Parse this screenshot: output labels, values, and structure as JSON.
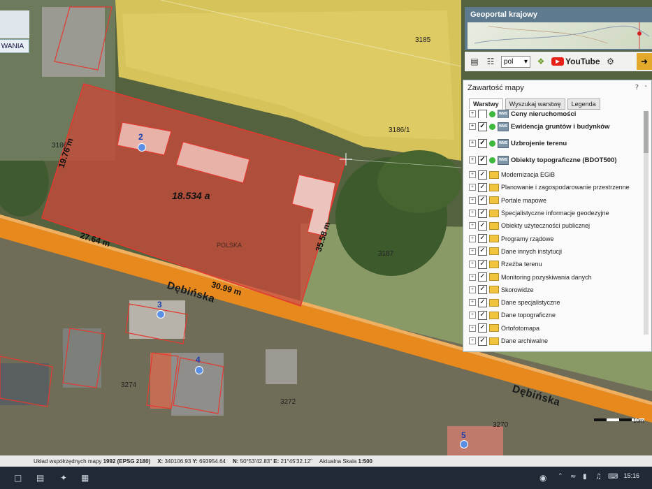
{
  "top_left": {
    "button_label": "WANIA"
  },
  "header": {
    "title": "Geoportal krajowy"
  },
  "toolbar": {
    "language": "pol",
    "youtube_label": "YouTube"
  },
  "panel": {
    "title": "Zawartość mapy",
    "help": "?",
    "close": "-",
    "tabs": [
      {
        "label": "Warstwy",
        "active": true
      },
      {
        "label": "Wyszukaj warstwę",
        "active": false
      },
      {
        "label": "Legenda",
        "active": false
      }
    ],
    "layers": [
      {
        "label": "Ceny nieruchomości",
        "checked": false,
        "kind": "wms"
      },
      {
        "label": "Ewidencja gruntów i budynków",
        "checked": true,
        "kind": "wms"
      },
      {
        "label": "Uzbrojenie terenu",
        "checked": true,
        "kind": "wms"
      },
      {
        "label": "Obiekty topograficzne (BDOT500)",
        "checked": true,
        "kind": "wms"
      },
      {
        "label": "Modernizacja EGiB",
        "checked": true,
        "kind": "folder"
      },
      {
        "label": "Planowanie i zagospodarowanie przestrzenne",
        "checked": true,
        "kind": "folder"
      },
      {
        "label": "Portale mapowe",
        "checked": true,
        "kind": "folder"
      },
      {
        "label": "Specjalistyczne informacje geodezyjne",
        "checked": true,
        "kind": "folder"
      },
      {
        "label": "Obiekty użyteczności publicznej",
        "checked": true,
        "kind": "folder"
      },
      {
        "label": "Programy rządowe",
        "checked": true,
        "kind": "folder"
      },
      {
        "label": "Dane innych instytucji",
        "checked": true,
        "kind": "folder"
      },
      {
        "label": "Rzeźba terenu",
        "checked": true,
        "kind": "folder"
      },
      {
        "label": "Monitoring pozyskiwania danych",
        "checked": true,
        "kind": "folder"
      },
      {
        "label": "Skorowidze",
        "checked": true,
        "kind": "folder"
      },
      {
        "label": "Dane specjalistyczne",
        "checked": true,
        "kind": "folder"
      },
      {
        "label": "Dane topograficzne",
        "checked": true,
        "kind": "folder"
      },
      {
        "label": "Ortofotomapa",
        "checked": true,
        "kind": "folder"
      },
      {
        "label": "Dane archiwalne",
        "checked": true,
        "kind": "folder"
      }
    ]
  },
  "map": {
    "parcels": [
      "3185",
      "3186/1",
      "3186",
      "3187",
      "3274",
      "3272",
      "3270"
    ],
    "area_label": "18.534 a",
    "country_label": "POLSKA",
    "measurements": [
      "27.64 m",
      "30.99 m",
      "35.58 m",
      "19.76 m"
    ],
    "street": "Dębińska",
    "address_pins": [
      "2",
      "3",
      "4",
      "5"
    ],
    "scale_text": "10m"
  },
  "status": {
    "crs_prefix": "Układ współrzędnych mapy",
    "crs_value": "1992",
    "crs_code": "(EPSG 2180)",
    "x_label": "X:",
    "x_value": "340106.93",
    "y_label": "Y:",
    "y_value": "693954.64",
    "n_label": "N:",
    "n_value": "50°53'42.83\"",
    "e_label": "E:",
    "e_value": "21°45'32.12\"",
    "scale_label": "Aktualna Skala",
    "scale_value": "1:500"
  },
  "taskbar": {
    "time": "15:16"
  },
  "colors": {
    "parcel_fill": "#c74a3a",
    "road": "#e8891e",
    "field": "#d8c45a",
    "header": "#5d7a8e"
  }
}
